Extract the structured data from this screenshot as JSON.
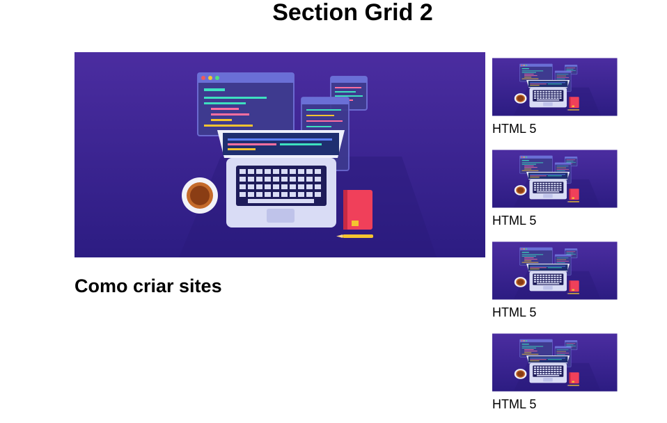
{
  "page": {
    "title": "Section Grid 2"
  },
  "main_article": {
    "heading": "Como criar sites",
    "image_icon": "laptop-code-illustration"
  },
  "side_cards": [
    {
      "label": "HTML 5",
      "image_icon": "laptop-code-illustration"
    },
    {
      "label": "HTML 5",
      "image_icon": "laptop-code-illustration"
    },
    {
      "label": "HTML 5",
      "image_icon": "laptop-code-illustration"
    },
    {
      "label": "HTML 5",
      "image_icon": "laptop-code-illustration"
    }
  ],
  "colors": {
    "illustration_bg_top": "#4a2c9e",
    "illustration_bg_bottom": "#2e1f86",
    "laptop_body": "#d9dcf5",
    "notebook_red": "#f0405a"
  }
}
